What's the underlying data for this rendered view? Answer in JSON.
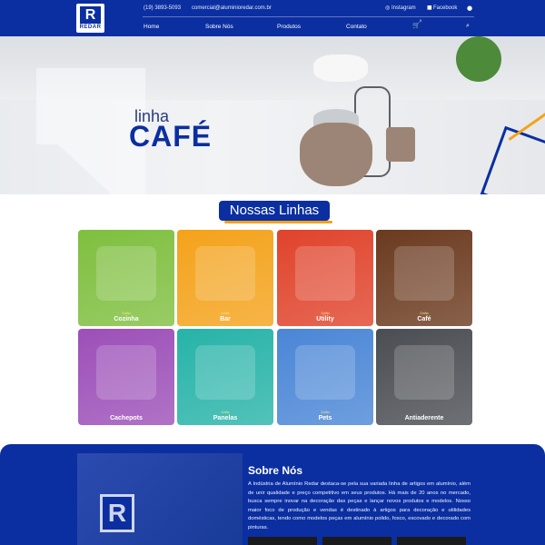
{
  "header": {
    "logo_text": "REDAR",
    "logo_letter": "R",
    "phone": "(19) 3893-5093",
    "email": "comercial@aluminioredar.com.br",
    "instagram": "Instagram",
    "facebook": "Facebook",
    "cart_count": "0",
    "nav": [
      "Home",
      "Sobre Nós",
      "Produtos",
      "Contato"
    ]
  },
  "hero": {
    "title_small": "linha",
    "title_big": "CAFÉ"
  },
  "lines": {
    "title": "Nossas Linhas",
    "small_word": "Linha",
    "items": [
      {
        "label": "Cozinha",
        "color": "#7fbf3f"
      },
      {
        "label": "Bar",
        "color": "#f4a21a"
      },
      {
        "label": "Utility",
        "color": "#e0432b"
      },
      {
        "label": "Café",
        "color": "#6b3a1f"
      },
      {
        "label": "Cachepots",
        "color": "#9c4fb8"
      },
      {
        "label": "Panelas",
        "color": "#27b3a8"
      },
      {
        "label": "Pets",
        "color": "#4a86d6"
      },
      {
        "label": "Antiaderente",
        "color": "#4a4d52"
      }
    ]
  },
  "about": {
    "title": "Sobre Nós",
    "text": "A Indústria de Alumínio Redar destaca-se pela sua variada linha de artigos em alumínio, além de unir qualidade e preço competitivo em seus produtos. Há mais de 20 anos no mercado, busca sempre inovar na decoração das peças e lançar novos produtos e modelos. Nosso maior foco de produção e vendas é destinado à artigos para decoração e utilidades domésticas, tendo como modelos peças em alumínio polido, fosco, escovado e decorado com pinturas."
  },
  "colors": {
    "brand_blue": "#0b2fa0",
    "accent_orange": "#f4a21a"
  }
}
